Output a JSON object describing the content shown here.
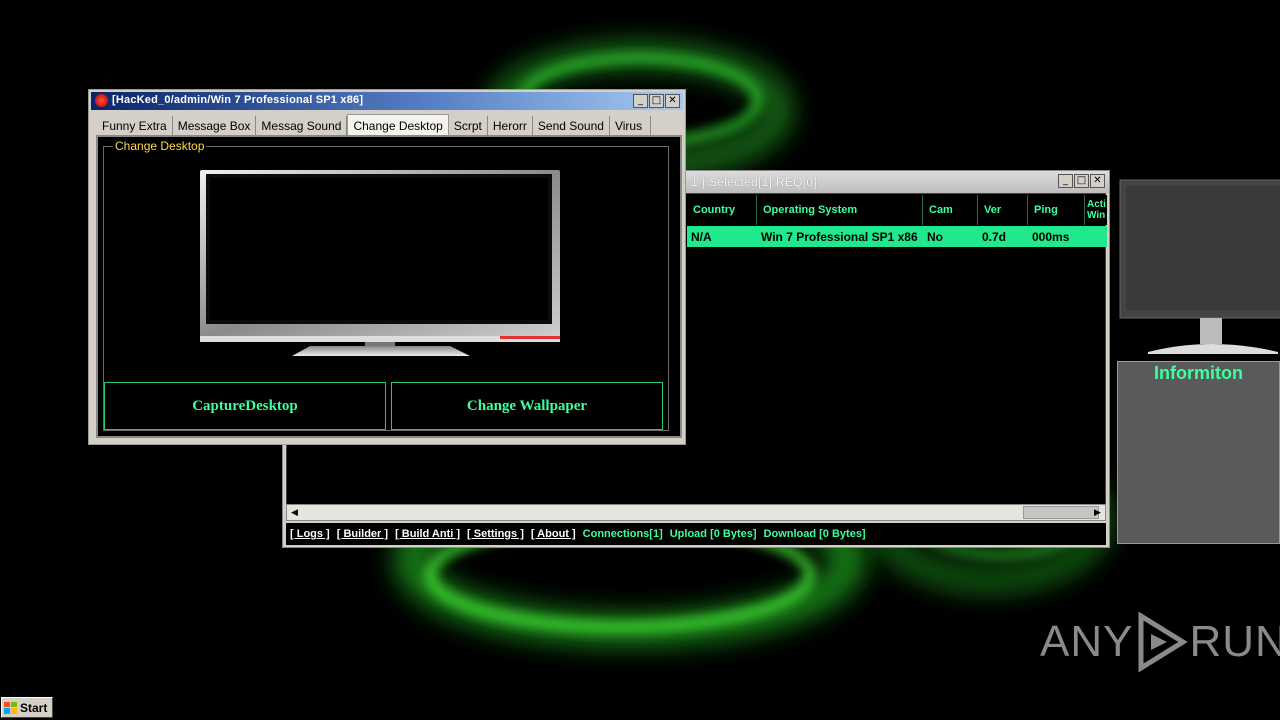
{
  "dialog": {
    "title": "[HacKed_0/admin/Win 7 Professional SP1 x86]",
    "tabs": [
      "Funny Extra",
      "Message Box",
      "Messag Sound",
      "Change Desktop",
      "Scrpt",
      "Herorr",
      "Send Sound",
      "Virus"
    ],
    "active_tab": "Change Desktop",
    "group_label": "Change Desktop",
    "capture_button": "CaptureDesktop",
    "wallpaper_button": "Change Wallpaper"
  },
  "main_window": {
    "title": "1 ]   Selected[1] REQ[0]",
    "columns": [
      "Country",
      "Operating System",
      "Cam",
      "Ver",
      "Ping",
      "Acti Win"
    ],
    "rows": [
      {
        "country": "N/A",
        "os": "Win 7 Professional SP1 x86",
        "cam": "No",
        "ver": "0.7d",
        "ping": "000ms"
      }
    ]
  },
  "status_bar": {
    "links": [
      "[ Logs ]",
      "[ Builder ]",
      "[ Build Anti ]",
      "[ Settings ]",
      "[ About ]"
    ],
    "connections": "Connections[1]",
    "upload": "Upload [0 Bytes]",
    "download": "Download [0 Bytes]"
  },
  "side_panel": {
    "title": "Informiton"
  },
  "taskbar": {
    "start_label": "Start"
  },
  "watermark": {
    "left": "ANY",
    "right": "RUN"
  },
  "colors": {
    "accent": "#3dff9e",
    "row_highlight": "#20e88c",
    "group_label": "#ffd94a"
  }
}
